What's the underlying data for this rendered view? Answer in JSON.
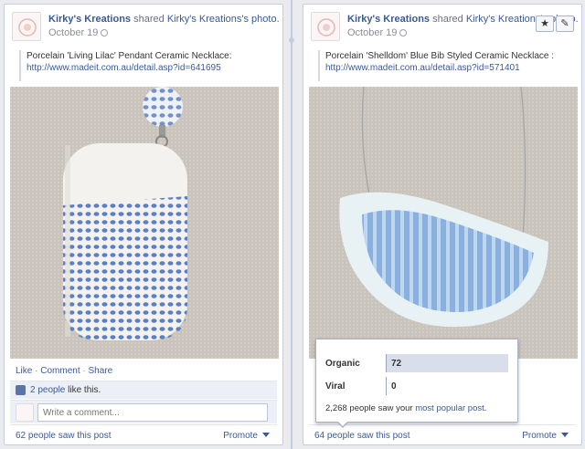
{
  "posts": [
    {
      "author": "Kirky's Kreations",
      "action": "shared",
      "shared_from": "Kirky's Kreations's photo.",
      "date": "October 19",
      "caption": "Porcelain 'Living Lilac' Pendant Ceramic Necklace:",
      "url": "http://www.madeit.com.au/detail.asp?id=641695",
      "actions": {
        "like": "Like",
        "comment": "Comment",
        "share": "Share",
        "sep": " · "
      },
      "likes_count": "2 people",
      "likes_suffix": " like this.",
      "comment_placeholder": "Write a comment...",
      "seen": "62 people saw this post",
      "promote": "Promote"
    },
    {
      "author": "Kirky's Kreations",
      "action": "shared",
      "shared_from": "Kirky's Kreations's photo.",
      "date": "October 19",
      "caption": "Porcelain 'Shelldom' Blue Bib Styled Ceramic Necklace :",
      "url": "http://www.madeit.com.au/detail.asp?id=571401",
      "seen": "64 people saw this post",
      "promote": "Promote",
      "buttons": {
        "star": "★",
        "edit": "✎"
      }
    }
  ],
  "reach_popover": {
    "rows": [
      {
        "label": "Organic",
        "value": "72",
        "fraction": 1.0
      },
      {
        "label": "Viral",
        "value": "0",
        "fraction": 0.0
      }
    ],
    "footer_prefix": "2,268 people saw your ",
    "footer_link": "most popular post",
    "footer_suffix": "."
  },
  "colors": {
    "link": "#3b5998",
    "bar": "#d8dfea",
    "page_bg": "#e9ebee"
  }
}
